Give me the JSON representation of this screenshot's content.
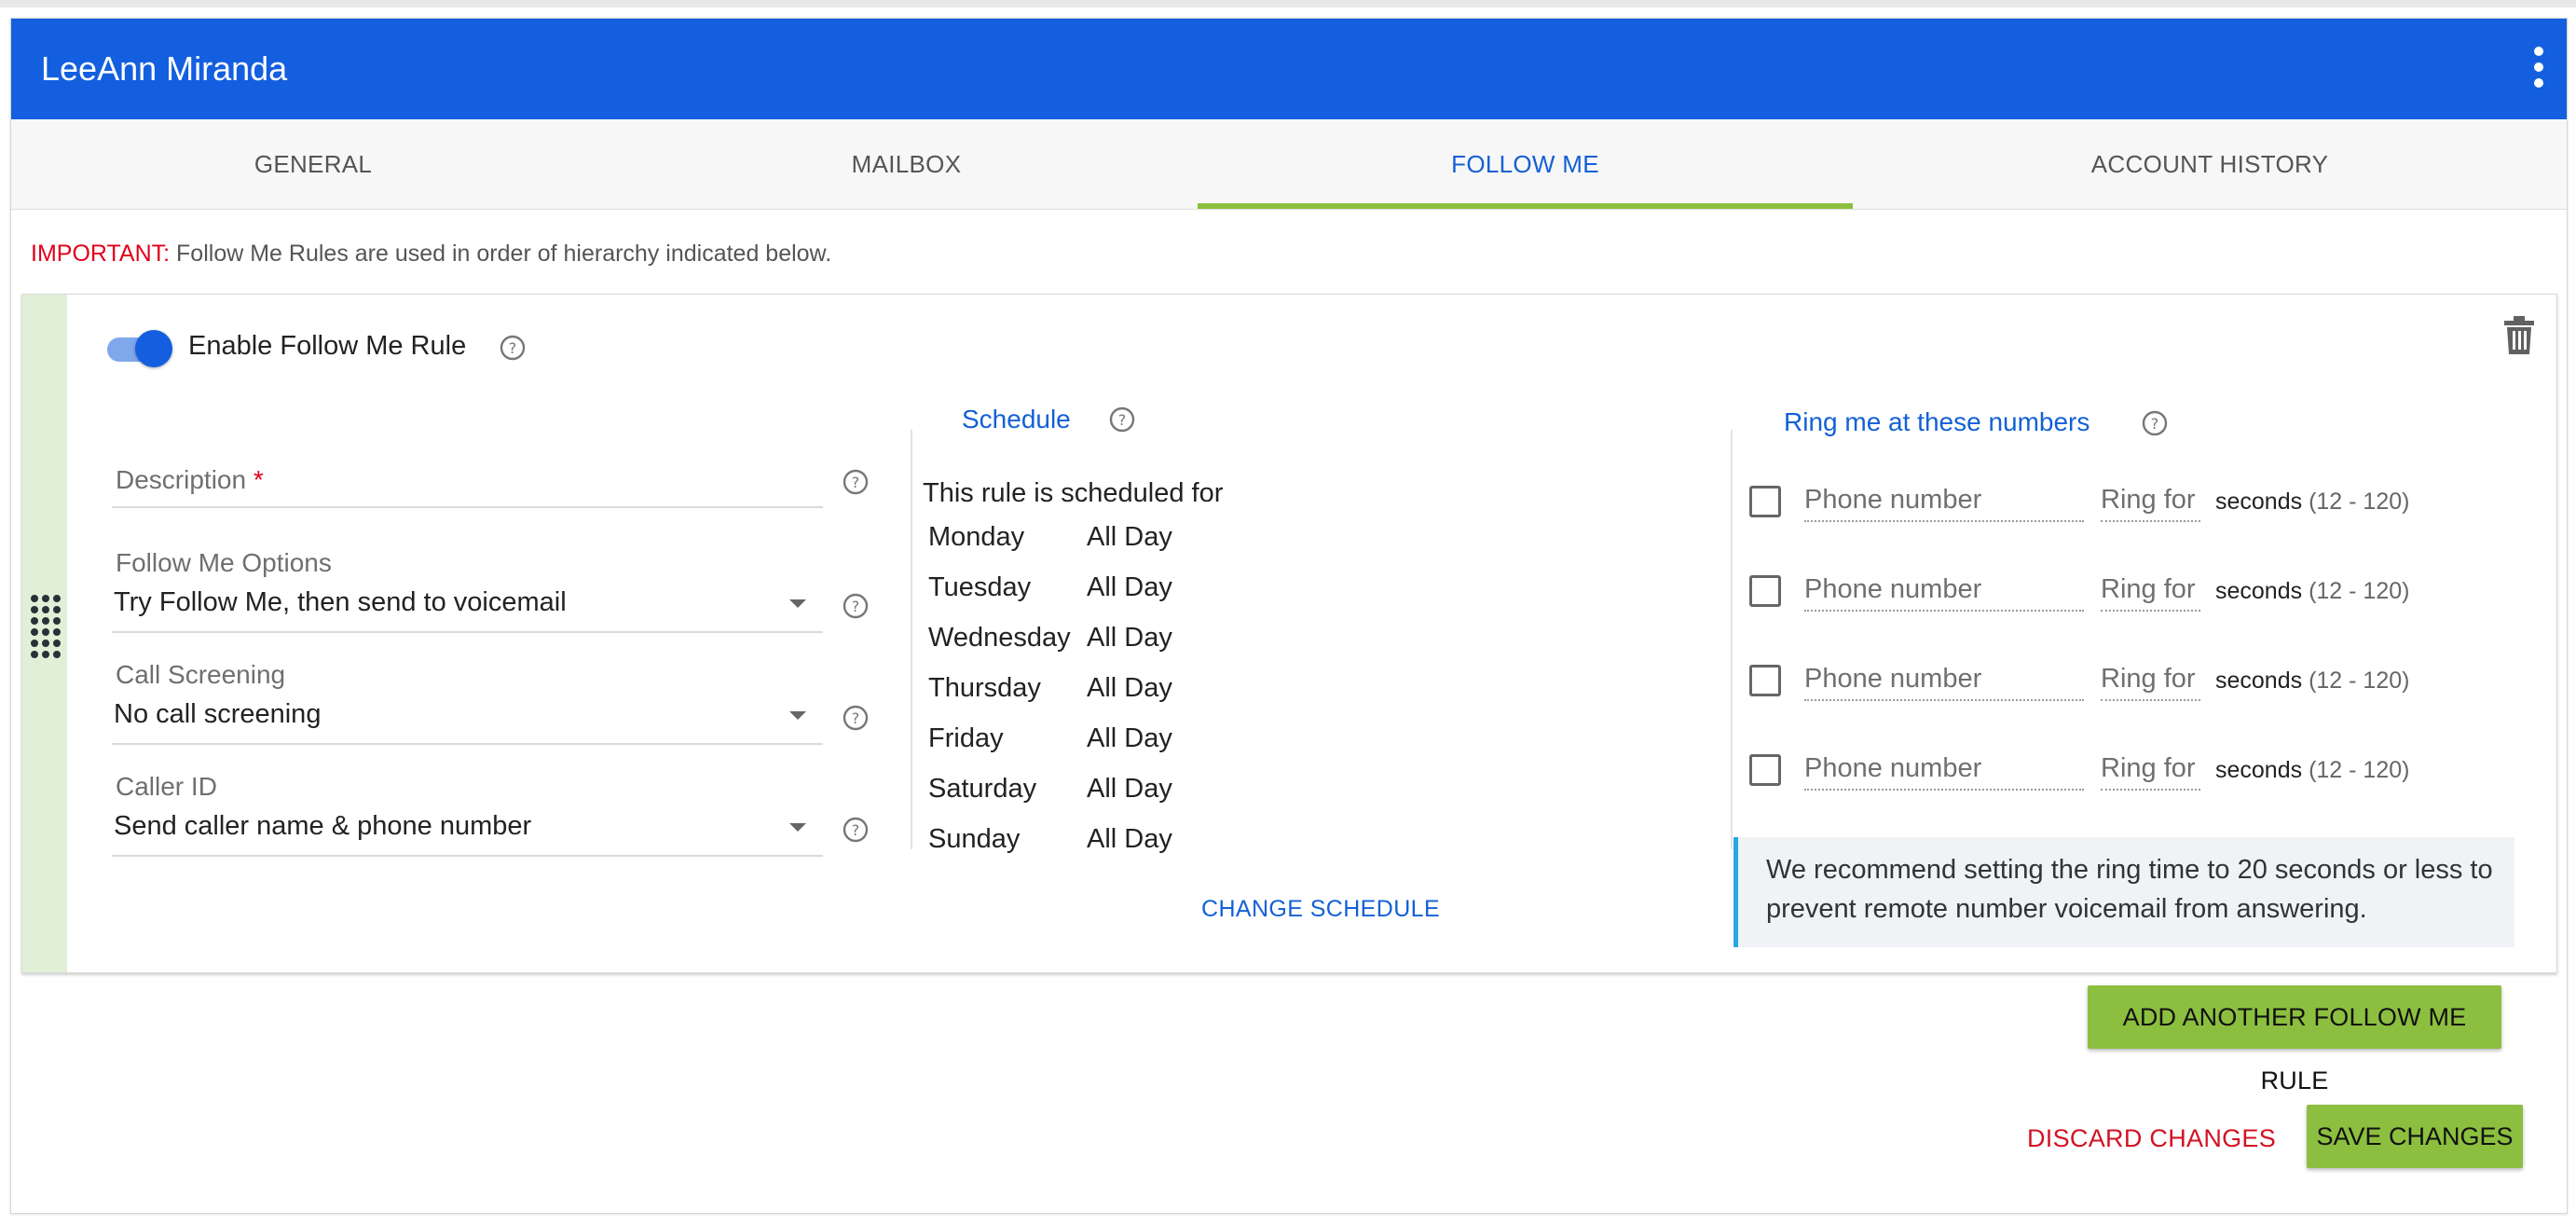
{
  "app": {
    "title": "LeeAnn Miranda"
  },
  "tabs": [
    {
      "label": "GENERAL"
    },
    {
      "label": "MAILBOX"
    },
    {
      "label": "FOLLOW ME",
      "active": true
    },
    {
      "label": "ACCOUNT HISTORY"
    }
  ],
  "notice": {
    "prefix": "IMPORTANT:",
    "text": " Follow Me Rules are used in order of hierarchy indicated below."
  },
  "rule": {
    "enable_label": "Enable Follow Me Rule",
    "enabled": true,
    "description": {
      "label": "Description",
      "required_mark": "*",
      "value": ""
    },
    "follow_me_options": {
      "label": "Follow Me Options",
      "value": "Try Follow Me, then send to voicemail"
    },
    "call_screening": {
      "label": "Call Screening",
      "value": "No call screening"
    },
    "caller_id": {
      "label": "Caller ID",
      "value": "Send caller name & phone number"
    },
    "schedule": {
      "title": "Schedule",
      "intro": "This rule is scheduled for",
      "days": [
        {
          "day": "Monday",
          "time": "All Day"
        },
        {
          "day": "Tuesday",
          "time": "All Day"
        },
        {
          "day": "Wednesday",
          "time": "All Day"
        },
        {
          "day": "Thursday",
          "time": "All Day"
        },
        {
          "day": "Friday",
          "time": "All Day"
        },
        {
          "day": "Saturday",
          "time": "All Day"
        },
        {
          "day": "Sunday",
          "time": "All Day"
        }
      ],
      "change_label": "CHANGE SCHEDULE"
    },
    "ring": {
      "title": "Ring me at these numbers",
      "rows": [
        {
          "checked": false,
          "phone_placeholder": "Phone number",
          "ring_label": "Ring for",
          "seconds_label": "seconds",
          "range": "(12 - 120)"
        },
        {
          "checked": false,
          "phone_placeholder": "Phone number",
          "ring_label": "Ring for",
          "seconds_label": "seconds",
          "range": "(12 - 120)"
        },
        {
          "checked": false,
          "phone_placeholder": "Phone number",
          "ring_label": "Ring for",
          "seconds_label": "seconds",
          "range": "(12 - 120)"
        },
        {
          "checked": false,
          "phone_placeholder": "Phone number",
          "ring_label": "Ring for",
          "seconds_label": "seconds",
          "range": "(12 - 120)"
        }
      ],
      "note": "We recommend setting the ring time to 20 seconds or less to prevent remote number voicemail from answering."
    }
  },
  "actions": {
    "add_rule": "ADD ANOTHER FOLLOW ME RULE",
    "discard": "DISCARD CHANGES",
    "save": "SAVE CHANGES"
  },
  "icons": {
    "menu": "more-vertical-icon",
    "delete": "trash-icon",
    "help": "help-circle-icon",
    "drag": "drag-handle-icon",
    "dropdown": "caret-down-icon"
  },
  "colors": {
    "primary": "#135fdf",
    "accent_green": "#8cbf3f",
    "danger": "#d31222",
    "important": "#e0001b",
    "note_border": "#2aa6e3"
  }
}
